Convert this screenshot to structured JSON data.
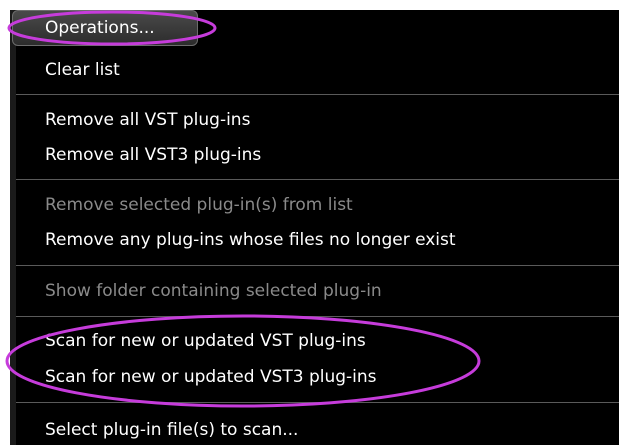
{
  "menu": {
    "button_label": "Operations...",
    "clear_list": "Clear list",
    "remove_vst": "Remove all VST plug-ins",
    "remove_vst3": "Remove all VST3 plug-ins",
    "remove_selected": "Remove selected plug-in(s) from list",
    "remove_missing": "Remove any plug-ins whose files no longer exist",
    "show_folder": "Show folder containing selected plug-in",
    "scan_vst": "Scan for new or updated VST plug-ins",
    "scan_vst3": "Scan for new or updated VST3 plug-ins",
    "select_files": "Select plug-in file(s) to scan..."
  },
  "colors": {
    "menu_background": "#000000",
    "text": "#ffffff",
    "disabled_text": "#8a8a8a",
    "highlight_ellipse": "#c63cdb"
  }
}
